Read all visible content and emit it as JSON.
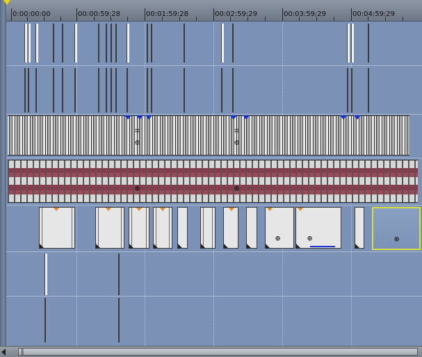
{
  "ruler": {
    "labels": [
      "0:00:00:00",
      "00:00:59:28",
      "00:01:59:28",
      "00:02:59:29",
      "00:03:59:29",
      "00:04:59:29"
    ]
  },
  "tracks": [
    {
      "name": "video-track-1",
      "type": "video"
    },
    {
      "name": "audio-track-1",
      "type": "audio"
    },
    {
      "name": "video-track-2",
      "type": "video"
    },
    {
      "name": "audio-track-2",
      "type": "audio"
    },
    {
      "name": "video-track-3",
      "type": "generated-media"
    },
    {
      "name": "video-track-4",
      "type": "video"
    },
    {
      "name": "audio-track-4",
      "type": "audio"
    }
  ],
  "icons": {
    "crop": "crop-icon",
    "pan": "event-pan-crop-icon",
    "scroll_left": "scroll-left-arrow-icon",
    "scroll_grip": "scroll-grip-icon"
  },
  "colors": {
    "timeline_bg": "#7b92b6",
    "waveform": "#8a3a4a",
    "selection": "#d8e040",
    "fade": "#e08a30",
    "transition": "#1a2fd0",
    "cursor_marker": "#e8d800"
  }
}
